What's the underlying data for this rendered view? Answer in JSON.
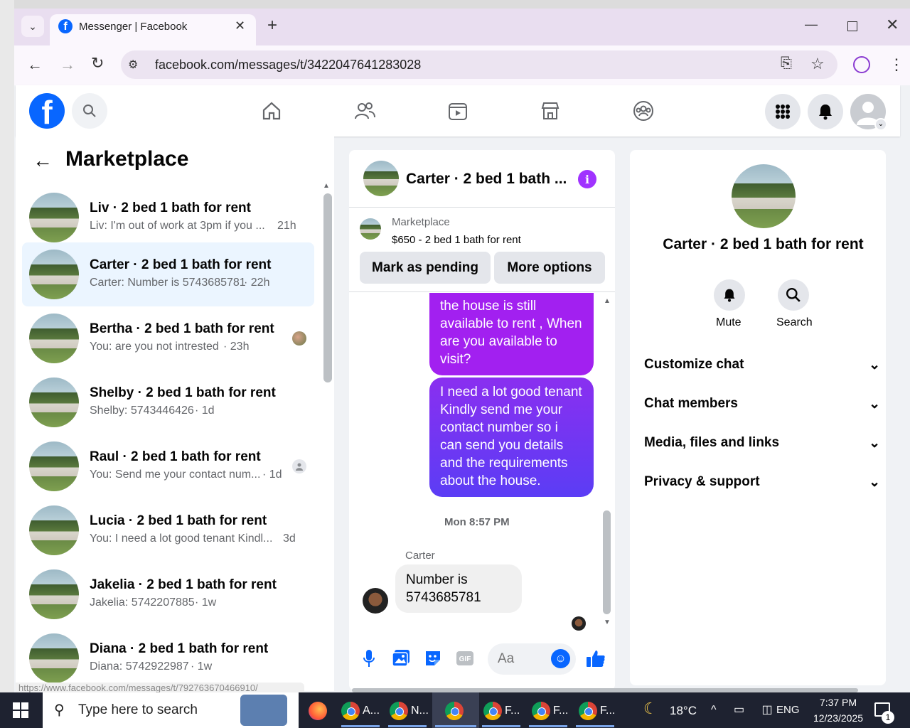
{
  "browser": {
    "tab_title": "Messenger | Facebook",
    "url": "facebook.com/messages/t/3422047641283028",
    "new_tab": "+",
    "status_url": "https://www.facebook.com/messages/t/792763670466910/"
  },
  "facebook": {
    "logo": "f",
    "nav_icons": [
      "home-icon",
      "friends-icon",
      "watch-icon",
      "marketplace-icon",
      "groups-icon"
    ]
  },
  "left": {
    "title": "Marketplace",
    "conversations": [
      {
        "name": "Liv · 2 bed 1 bath for rent",
        "preview": "Liv: I'm out of work at 3pm if you ...",
        "time": "21h"
      },
      {
        "name": "Carter · 2 bed 1 bath for rent",
        "preview": "Carter: Number is 5743685781",
        "time": "· 22h"
      },
      {
        "name": "Bertha · 2 bed 1 bath for rent",
        "preview": "You: are you not intrested",
        "time": "· 23h"
      },
      {
        "name": "Shelby · 2 bed 1 bath for rent",
        "preview": "Shelby: 5743446426",
        "time": "· 1d"
      },
      {
        "name": "Raul · 2 bed 1 bath for rent",
        "preview": "You: Send me your contact num...",
        "time": "· 1d"
      },
      {
        "name": "Lucia · 2 bed 1 bath for rent",
        "preview": "You: I need a lot good tenant Kindl...",
        "time": "3d"
      },
      {
        "name": "Jakelia · 2 bed 1 bath for rent",
        "preview": "Jakelia: 5742207885",
        "time": "· 1w"
      },
      {
        "name": "Diana · 2 bed 1 bath for rent",
        "preview": "Diana: 5742922987",
        "time": "· 1w"
      }
    ]
  },
  "chat": {
    "title": "Carter · 2 bed 1 bath ...",
    "listing_label": "Marketplace",
    "listing_price": "$650 - 2 bed 1 bath for rent",
    "mark_pending": "Mark as pending",
    "more_options": "More options",
    "msg1": "the house is still available to rent , When are you available to visit?",
    "msg2": "I need a lot good tenant Kindly send me your contact number so i can send you details and the requirements about the house.",
    "timestamp": "Mon 8:57 PM",
    "sender": "Carter",
    "msg3": "Number is 5743685781",
    "input_placeholder": "Aa"
  },
  "right": {
    "title": "Carter · 2 bed 1 bath for rent",
    "mute": "Mute",
    "search": "Search",
    "sections": [
      "Customize chat",
      "Chat members",
      "Media, files and links",
      "Privacy & support"
    ]
  },
  "taskbar": {
    "search_text": "Type here to search",
    "apps": [
      "A...",
      "N...",
      "",
      "F...",
      "F...",
      "F..."
    ],
    "temp": "18°C",
    "lang": "ENG",
    "time": "7:37 PM",
    "date": "12/23/2025",
    "notif_count": "1"
  }
}
